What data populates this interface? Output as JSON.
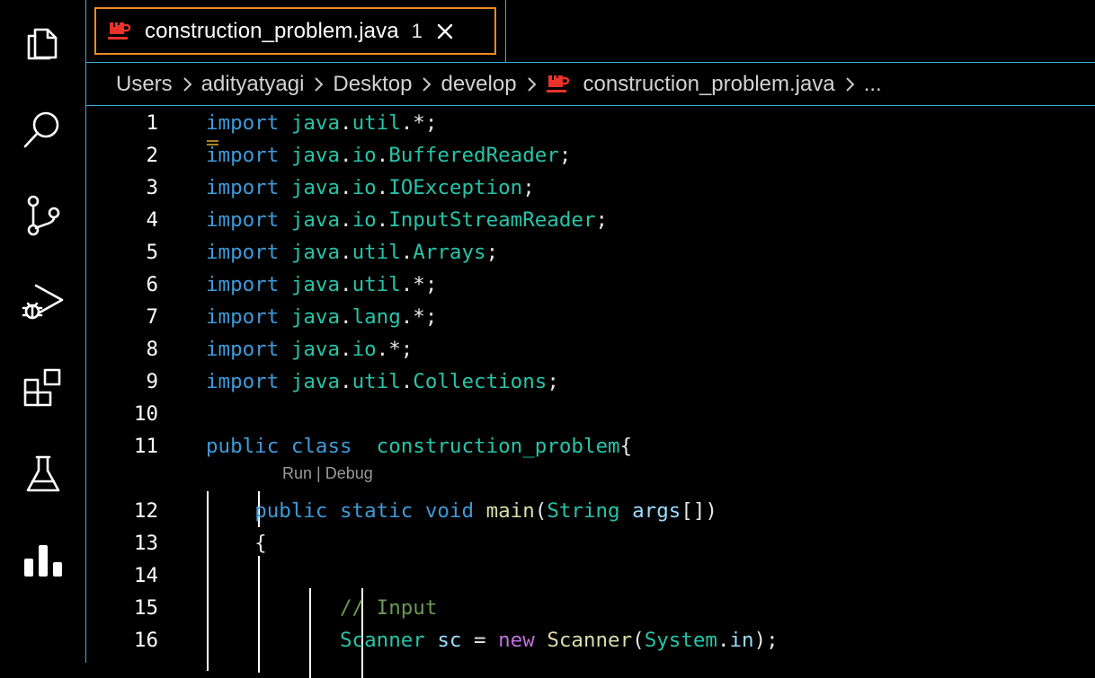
{
  "activity_bar": {
    "icons": [
      "explorer-icon",
      "search-icon",
      "source-control-icon",
      "run-debug-icon",
      "extensions-icon",
      "testing-icon",
      "stats-icon"
    ]
  },
  "tab": {
    "label": "construction_problem.java",
    "badge": "1",
    "icon": "java-icon",
    "accent": "#f08a24"
  },
  "breadcrumb": {
    "items": [
      "Users",
      "adityatyagi",
      "Desktop",
      "develop",
      "construction_problem.java",
      "..."
    ]
  },
  "editor": {
    "codelens": "Run | Debug",
    "lines": [
      {
        "num": "1",
        "tokens": [
          [
            "kw",
            "import"
          ],
          [
            "pu",
            " "
          ],
          [
            "pk",
            "java"
          ],
          [
            "pu",
            "."
          ],
          [
            "pk",
            "util"
          ],
          [
            "pu",
            ".*;"
          ]
        ]
      },
      {
        "num": "2",
        "tokens": [
          [
            "kw",
            "import"
          ],
          [
            "pu",
            " "
          ],
          [
            "pk",
            "java"
          ],
          [
            "pu",
            "."
          ],
          [
            "pk",
            "io"
          ],
          [
            "pu",
            "."
          ],
          [
            "cl",
            "BufferedReader"
          ],
          [
            "pu",
            ";"
          ]
        ]
      },
      {
        "num": "3",
        "tokens": [
          [
            "kw",
            "import"
          ],
          [
            "pu",
            " "
          ],
          [
            "pk",
            "java"
          ],
          [
            "pu",
            "."
          ],
          [
            "pk",
            "io"
          ],
          [
            "pu",
            "."
          ],
          [
            "cl",
            "IOException"
          ],
          [
            "pu",
            ";"
          ]
        ]
      },
      {
        "num": "4",
        "tokens": [
          [
            "kw",
            "import"
          ],
          [
            "pu",
            " "
          ],
          [
            "pk",
            "java"
          ],
          [
            "pu",
            "."
          ],
          [
            "pk",
            "io"
          ],
          [
            "pu",
            "."
          ],
          [
            "cl",
            "InputStreamReader"
          ],
          [
            "pu",
            ";"
          ]
        ]
      },
      {
        "num": "5",
        "tokens": [
          [
            "kw",
            "import"
          ],
          [
            "pu",
            " "
          ],
          [
            "pk",
            "java"
          ],
          [
            "pu",
            "."
          ],
          [
            "pk",
            "util"
          ],
          [
            "pu",
            "."
          ],
          [
            "cl",
            "Arrays"
          ],
          [
            "pu",
            ";"
          ]
        ]
      },
      {
        "num": "6",
        "tokens": [
          [
            "kw",
            "import"
          ],
          [
            "pu",
            " "
          ],
          [
            "pk",
            "java"
          ],
          [
            "pu",
            "."
          ],
          [
            "pk",
            "util"
          ],
          [
            "pu",
            ".*;"
          ]
        ]
      },
      {
        "num": "7",
        "tokens": [
          [
            "kw",
            "import"
          ],
          [
            "pu",
            " "
          ],
          [
            "pk",
            "java"
          ],
          [
            "pu",
            "."
          ],
          [
            "pk",
            "lang"
          ],
          [
            "pu",
            ".*;"
          ]
        ]
      },
      {
        "num": "8",
        "tokens": [
          [
            "kw",
            "import"
          ],
          [
            "pu",
            " "
          ],
          [
            "pk",
            "java"
          ],
          [
            "pu",
            "."
          ],
          [
            "pk",
            "io"
          ],
          [
            "pu",
            ".*;"
          ]
        ]
      },
      {
        "num": "9",
        "tokens": [
          [
            "kw",
            "import"
          ],
          [
            "pu",
            " "
          ],
          [
            "pk",
            "java"
          ],
          [
            "pu",
            "."
          ],
          [
            "pk",
            "util"
          ],
          [
            "pu",
            "."
          ],
          [
            "cl",
            "Collections"
          ],
          [
            "pu",
            ";"
          ]
        ]
      },
      {
        "num": "10",
        "tokens": []
      },
      {
        "num": "11",
        "tokens": [
          [
            "kw",
            "public"
          ],
          [
            "pu",
            " "
          ],
          [
            "kw",
            "class"
          ],
          [
            "pu",
            "  "
          ],
          [
            "cl",
            "construction_problem"
          ],
          [
            "pu",
            "{"
          ]
        ]
      },
      {
        "num": "12",
        "tokens": [
          [
            "pu",
            "    "
          ],
          [
            "kw",
            "public"
          ],
          [
            "pu",
            " "
          ],
          [
            "kw",
            "static"
          ],
          [
            "pu",
            " "
          ],
          [
            "kw",
            "void"
          ],
          [
            "pu",
            " "
          ],
          [
            "fn",
            "main"
          ],
          [
            "pu",
            "("
          ],
          [
            "cl",
            "String"
          ],
          [
            "pu",
            " "
          ],
          [
            "vr",
            "args"
          ],
          [
            "pu",
            "[])"
          ]
        ]
      },
      {
        "num": "13",
        "tokens": [
          [
            "pu",
            "    {"
          ]
        ]
      },
      {
        "num": "14",
        "tokens": []
      },
      {
        "num": "15",
        "tokens": [
          [
            "pu",
            "           "
          ],
          [
            "cm",
            "// Input"
          ]
        ]
      },
      {
        "num": "16",
        "tokens": [
          [
            "pu",
            "           "
          ],
          [
            "cl",
            "Scanner"
          ],
          [
            "pu",
            " "
          ],
          [
            "vr",
            "sc"
          ],
          [
            "pu",
            " = "
          ],
          [
            "kw2",
            "new"
          ],
          [
            "pu",
            " "
          ],
          [
            "fn",
            "Scanner"
          ],
          [
            "pu",
            "("
          ],
          [
            "cl",
            "System"
          ],
          [
            "pu",
            "."
          ],
          [
            "vr",
            "in"
          ],
          [
            "pu",
            ");"
          ]
        ]
      }
    ]
  }
}
